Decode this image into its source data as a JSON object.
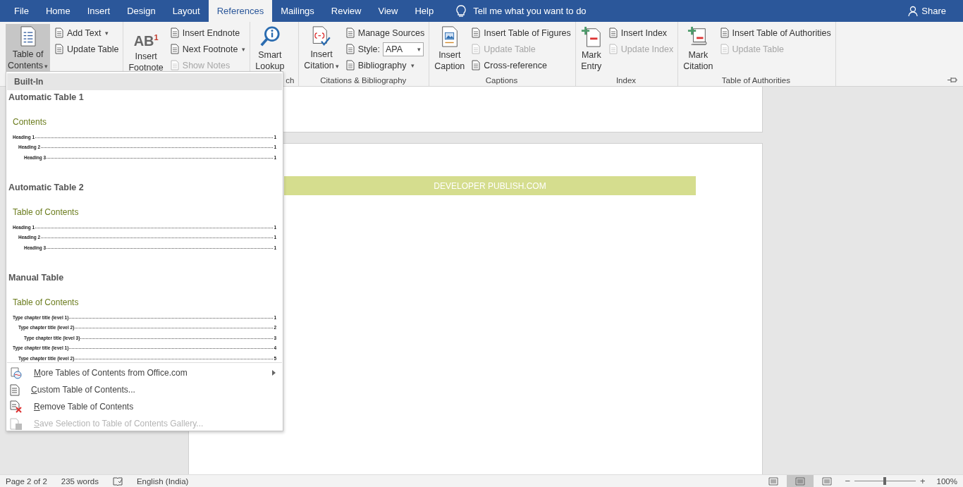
{
  "tabs": [
    {
      "label": "File",
      "selected": false
    },
    {
      "label": "Home",
      "selected": false
    },
    {
      "label": "Insert",
      "selected": false
    },
    {
      "label": "Design",
      "selected": false
    },
    {
      "label": "Layout",
      "selected": false
    },
    {
      "label": "References",
      "selected": true
    },
    {
      "label": "Mailings",
      "selected": false
    },
    {
      "label": "Review",
      "selected": false
    },
    {
      "label": "View",
      "selected": false
    },
    {
      "label": "Help",
      "selected": false
    }
  ],
  "tell_me": "Tell me what you want to do",
  "share": "Share",
  "ribbon": {
    "groups": [
      {
        "large": {
          "lines": [
            "Table of",
            "Contents"
          ],
          "caret": "▾",
          "selected": true
        },
        "small": [
          {
            "kind": "button",
            "label": "Add Text",
            "caret": "▾",
            "disabled": false
          },
          {
            "kind": "button",
            "label": "Update Table",
            "disabled": false
          }
        ]
      },
      {
        "large": {
          "lines": [
            "Insert",
            "Footnote"
          ],
          "icon_text": "AB$^{1}$",
          "selected": false
        },
        "small": [
          {
            "kind": "button",
            "label": "Insert Endnote",
            "disabled": false
          },
          {
            "kind": "button",
            "label": "Next Footnote",
            "caret": "▾",
            "disabled": false
          },
          {
            "kind": "button",
            "label": "Show Notes",
            "disabled": true
          }
        ]
      },
      {
        "label": "ch",
        "large": {
          "lines": [
            "Smart",
            "Lookup"
          ],
          "selected": false
        }
      },
      {
        "label": "Citations & Bibliography",
        "large": {
          "lines": [
            "Insert",
            "Citation"
          ],
          "caret": "▾",
          "selected": false
        },
        "small": [
          {
            "kind": "button",
            "label": "Manage Sources",
            "disabled": false
          },
          {
            "kind": "select",
            "label": "Style:",
            "value": "APA",
            "caret": "▾"
          },
          {
            "kind": "button",
            "label": "Bibliography",
            "caret": "▾",
            "disabled": false
          }
        ]
      },
      {
        "label": "Captions",
        "large": {
          "lines": [
            "Insert",
            "Caption"
          ],
          "selected": false
        },
        "small": [
          {
            "kind": "button",
            "label": "Insert Table of Figures",
            "disabled": false
          },
          {
            "kind": "button",
            "label": "Update Table",
            "disabled": true
          },
          {
            "kind": "button",
            "label": "Cross-reference",
            "disabled": false
          }
        ]
      },
      {
        "label": "Index",
        "large": {
          "lines": [
            "Mark",
            "Entry"
          ],
          "selected": false
        },
        "small": [
          {
            "kind": "button",
            "label": "Insert Index",
            "disabled": false
          },
          {
            "kind": "button",
            "label": "Update Index",
            "disabled": true
          }
        ]
      },
      {
        "label": "Table of Authorities",
        "large": {
          "lines": [
            "Mark",
            "Citation"
          ],
          "selected": false
        },
        "small": [
          {
            "kind": "button",
            "label": "Insert Table of Authorities",
            "disabled": false
          },
          {
            "kind": "button",
            "label": "Update Table",
            "disabled": true
          }
        ]
      }
    ]
  },
  "menu": {
    "header": "Built-In",
    "gallery": [
      {
        "title": "Automatic Table 1",
        "heading": "Contents",
        "entries": [
          {
            "text": "Heading 1",
            "page": "1",
            "children": [
              {
                "text": "Heading 2",
                "page": "1",
                "children": [
                  {
                    "text": "Heading 3",
                    "page": "1"
                  }
                ]
              }
            ]
          }
        ]
      },
      {
        "title": "Automatic Table 2",
        "heading": "Table of Contents",
        "entries": [
          {
            "text": "Heading 1",
            "page": "1",
            "children": [
              {
                "text": "Heading 2",
                "page": "1",
                "children": [
                  {
                    "text": "Heading 3",
                    "page": "1"
                  }
                ]
              }
            ]
          }
        ]
      },
      {
        "title": "Manual Table",
        "heading": "Table of Contents",
        "entries": [
          {
            "text": "Type chapter title (level 1)",
            "page": "1",
            "children": [
              {
                "text": "Type chapter title (level 2)",
                "page": "2",
                "children": [
                  {
                    "text": "Type chapter title (level 3)",
                    "page": "3"
                  }
                ]
              }
            ]
          },
          {
            "text": "Type chapter title (level 1)",
            "page": "4",
            "children": [
              {
                "text": "Type chapter title (level 2)",
                "page": "5"
              }
            ]
          }
        ]
      }
    ],
    "items": [
      {
        "label": "More Tables of Contents from Office.com",
        "submenu": true,
        "disabled": false
      },
      {
        "label": "Custom Table of Contents...",
        "submenu": false,
        "disabled": false
      },
      {
        "label": "Remove Table of Contents",
        "submenu": false,
        "disabled": false
      },
      {
        "label": "Save Selection to Table of Contents Gallery...",
        "submenu": false,
        "disabled": true
      }
    ]
  },
  "document": {
    "banner": "DEVELOPER PUBLISH.COM"
  },
  "status_bar": {
    "page": "Page 2 of 2",
    "words": "235 words",
    "language": "English (India)",
    "views": [
      {
        "selected": false
      },
      {
        "selected": true
      },
      {
        "selected": false
      }
    ],
    "zoom_out": "−",
    "zoom_in": "+",
    "zoom": {
      "level": 0.5
    },
    "zoom_reading": "100%"
  }
}
